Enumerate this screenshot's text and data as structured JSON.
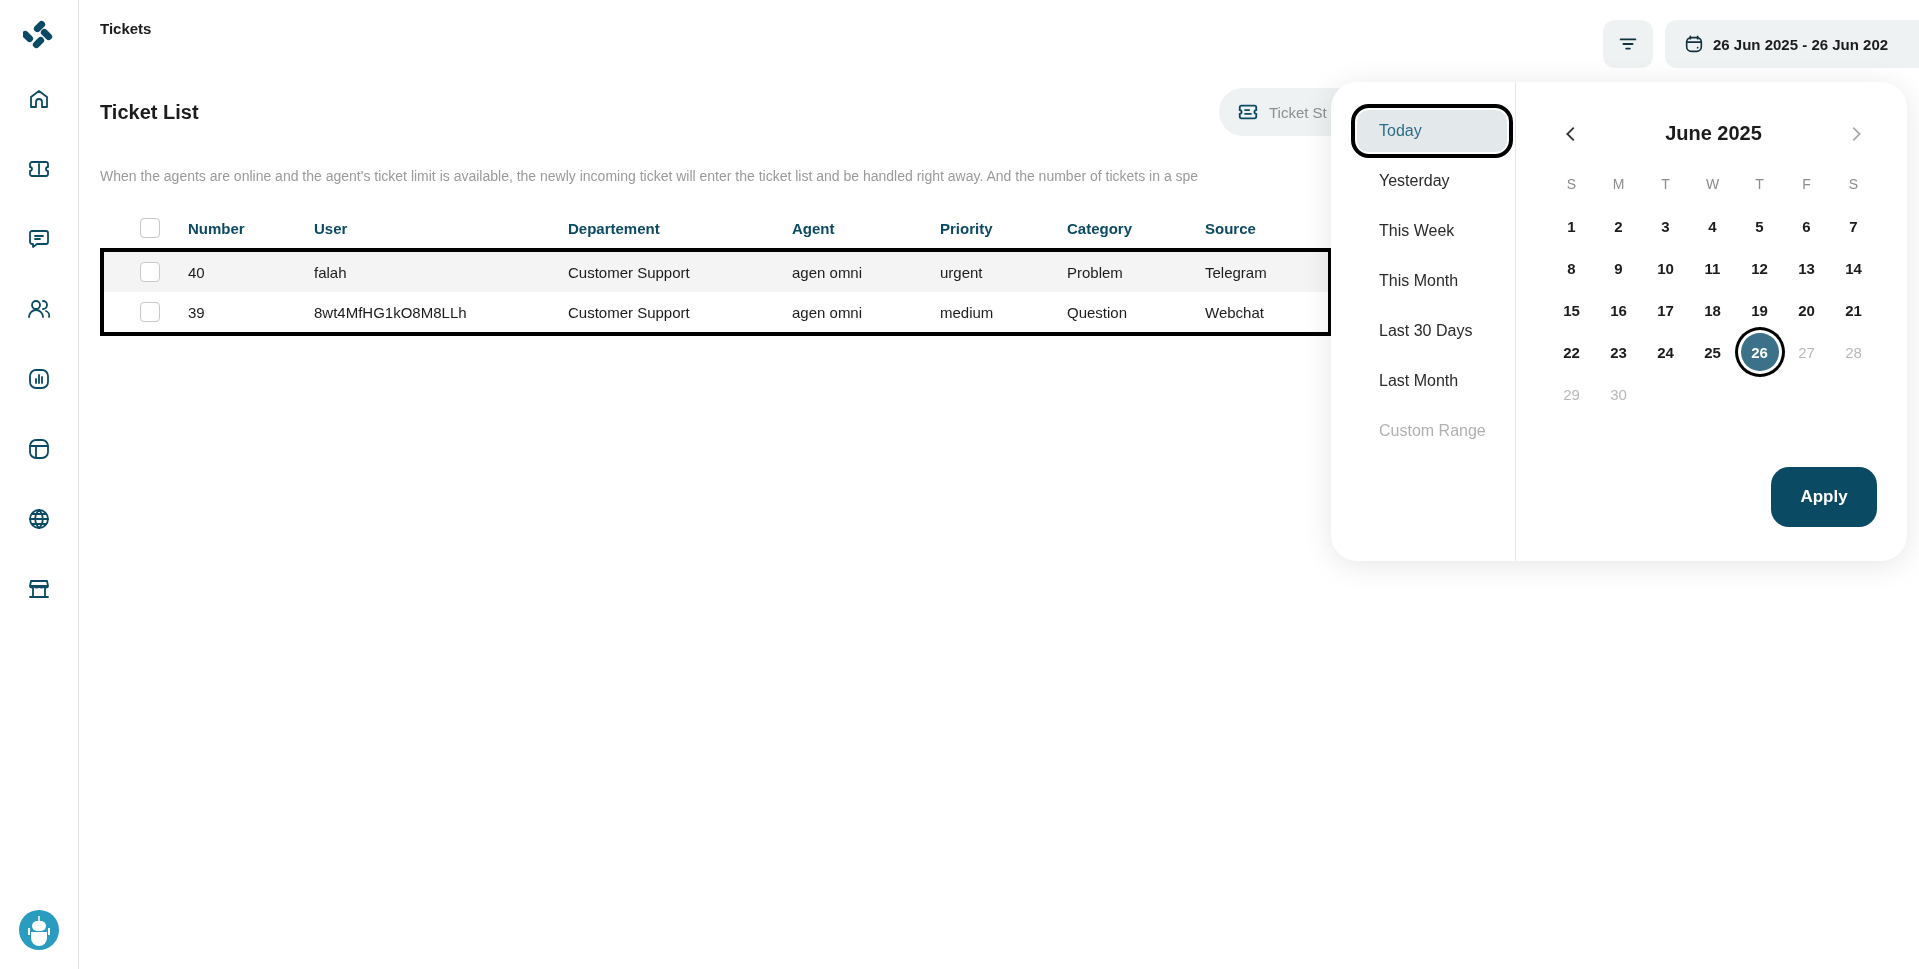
{
  "header": {
    "title": "Tickets",
    "date_range": "26 Jun 2025 - 26 Jun 202"
  },
  "page": {
    "title": "Ticket List",
    "status_button": "Ticket St",
    "description": "When the agents are online and the agent's ticket limit is available, the newly incoming ticket will enter the ticket list and be handled right away. And the number of tickets in a spe"
  },
  "table": {
    "all_checked": false,
    "rows_highlighted": true,
    "columns": [
      "Number",
      "User",
      "Departement",
      "Agent",
      "Priority",
      "Category",
      "Source"
    ],
    "rows": [
      {
        "checked": false,
        "cells": [
          "40",
          "falah",
          "Customer Support",
          "agen omni",
          "urgent",
          "Problem",
          "Telegram"
        ]
      },
      {
        "checked": false,
        "cells": [
          "39",
          "8wt4MfHG1kO8M8LLh",
          "Customer Support",
          "agen omni",
          "medium",
          "Question",
          "Webchat"
        ]
      }
    ]
  },
  "date_picker": {
    "presets": [
      {
        "label": "Today",
        "selected": true,
        "highlighted": true,
        "disabled": false
      },
      {
        "label": "Yesterday",
        "selected": false,
        "highlighted": false,
        "disabled": false
      },
      {
        "label": "This Week",
        "selected": false,
        "highlighted": false,
        "disabled": false
      },
      {
        "label": "This Month",
        "selected": false,
        "highlighted": false,
        "disabled": false
      },
      {
        "label": "Last 30 Days",
        "selected": false,
        "highlighted": false,
        "disabled": false
      },
      {
        "label": "Last Month",
        "selected": false,
        "highlighted": false,
        "disabled": false
      },
      {
        "label": "Custom Range",
        "selected": false,
        "highlighted": false,
        "disabled": true
      }
    ],
    "month": "June 2025",
    "prev_enabled": true,
    "next_enabled": false,
    "weekdays": [
      "S",
      "M",
      "T",
      "W",
      "T",
      "F",
      "S"
    ],
    "weeks": [
      [
        {
          "label": "1",
          "muted": false,
          "selected": false
        },
        {
          "label": "2",
          "muted": false,
          "selected": false
        },
        {
          "label": "3",
          "muted": false,
          "selected": false
        },
        {
          "label": "4",
          "muted": false,
          "selected": false
        },
        {
          "label": "5",
          "muted": false,
          "selected": false
        },
        {
          "label": "6",
          "muted": false,
          "selected": false
        },
        {
          "label": "7",
          "muted": false,
          "selected": false
        }
      ],
      [
        {
          "label": "8",
          "muted": false,
          "selected": false
        },
        {
          "label": "9",
          "muted": false,
          "selected": false
        },
        {
          "label": "10",
          "muted": false,
          "selected": false
        },
        {
          "label": "11",
          "muted": false,
          "selected": false
        },
        {
          "label": "12",
          "muted": false,
          "selected": false
        },
        {
          "label": "13",
          "muted": false,
          "selected": false
        },
        {
          "label": "14",
          "muted": false,
          "selected": false
        }
      ],
      [
        {
          "label": "15",
          "muted": false,
          "selected": false
        },
        {
          "label": "16",
          "muted": false,
          "selected": false
        },
        {
          "label": "17",
          "muted": false,
          "selected": false
        },
        {
          "label": "18",
          "muted": false,
          "selected": false
        },
        {
          "label": "19",
          "muted": false,
          "selected": false
        },
        {
          "label": "20",
          "muted": false,
          "selected": false
        },
        {
          "label": "21",
          "muted": false,
          "selected": false
        }
      ],
      [
        {
          "label": "22",
          "muted": false,
          "selected": false
        },
        {
          "label": "23",
          "muted": false,
          "selected": false
        },
        {
          "label": "24",
          "muted": false,
          "selected": false
        },
        {
          "label": "25",
          "muted": false,
          "selected": false
        },
        {
          "label": "26",
          "muted": false,
          "selected": true,
          "highlighted": true
        },
        {
          "label": "27",
          "muted": true,
          "selected": false
        },
        {
          "label": "28",
          "muted": true,
          "selected": false
        }
      ],
      [
        {
          "label": "29",
          "muted": true,
          "selected": false
        },
        {
          "label": "30",
          "muted": true,
          "selected": false
        }
      ]
    ],
    "apply": "Apply"
  }
}
